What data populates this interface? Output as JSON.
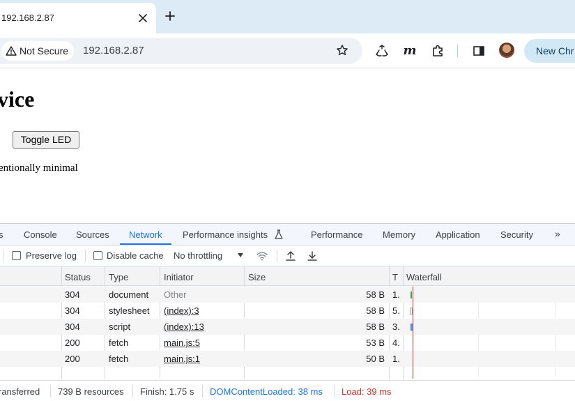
{
  "browser": {
    "tab_title": "192.168.2.87",
    "security_chip": "Not Secure",
    "url": "192.168.2.87",
    "new_chrome_label": "New Chr"
  },
  "page": {
    "heading": "vice",
    "toggle_button": "Toggle LED",
    "text": "entionally minimal"
  },
  "devtools": {
    "tabs": [
      "s",
      "Console",
      "Sources",
      "Network",
      "Performance insights",
      "Performance",
      "Memory",
      "Application",
      "Security",
      "»"
    ],
    "active_tab": "Network",
    "toolbar": {
      "preserve_log": "Preserve log",
      "disable_cache": "Disable cache",
      "throttling": "No throttling"
    },
    "columns": [
      "Status",
      "Type",
      "Initiator",
      "Size",
      "T",
      "Waterfall"
    ],
    "rows": [
      {
        "status": "304",
        "type": "document",
        "initiator": "Other",
        "size": "58 B",
        "time": "1."
      },
      {
        "status": "304",
        "type": "stylesheet",
        "initiator": "(index):3",
        "size": "58 B",
        "time": "5."
      },
      {
        "status": "304",
        "type": "script",
        "initiator": "(index):13",
        "size": "58 B",
        "time": "3."
      },
      {
        "status": "200",
        "type": "fetch",
        "initiator": "main.js:5",
        "size": "53 B",
        "time": "4."
      },
      {
        "status": "200",
        "type": "fetch",
        "initiator": "main.js:1",
        "size": "50 B",
        "time": "1."
      }
    ],
    "status_bar": {
      "transferred": "ransferred",
      "resources": "739 B resources",
      "finish": "Finish: 1.75 s",
      "dom_content_loaded": "DOMContentLoaded: 38 ms",
      "load": "Load: 39 ms"
    }
  },
  "colors": {
    "accent": "#1a73e8",
    "load_red": "#d93025",
    "tabstrip": "#dcebf5"
  },
  "icons": [
    "close-icon",
    "plus-icon",
    "warning-icon",
    "star-icon",
    "recycle-icon",
    "m-extension-icon",
    "puzzle-icon",
    "side-panel-icon",
    "wifi-icon",
    "upload-icon",
    "download-icon",
    "beaker-icon"
  ]
}
